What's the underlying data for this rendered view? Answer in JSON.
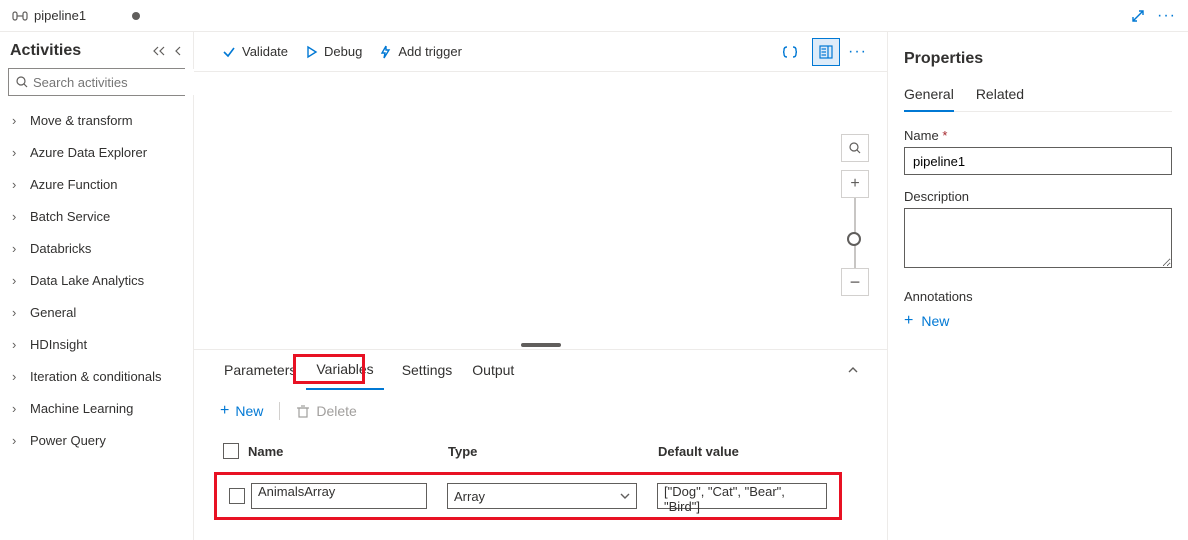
{
  "tab": {
    "title": "pipeline1"
  },
  "topbar_icons": {
    "expand": "expand",
    "more": "more"
  },
  "sidebar": {
    "title": "Activities",
    "search_placeholder": "Search activities",
    "categories": [
      "Move & transform",
      "Azure Data Explorer",
      "Azure Function",
      "Batch Service",
      "Databricks",
      "Data Lake Analytics",
      "General",
      "HDInsight",
      "Iteration & conditionals",
      "Machine Learning",
      "Power Query"
    ]
  },
  "toolbar": {
    "validate": "Validate",
    "debug": "Debug",
    "addtrigger": "Add trigger"
  },
  "bottom": {
    "tabs": {
      "parameters": "Parameters",
      "variables": "Variables",
      "settings": "Settings",
      "output": "Output"
    },
    "actions": {
      "new": "New",
      "delete": "Delete"
    },
    "columns": {
      "name": "Name",
      "type": "Type",
      "default": "Default value"
    },
    "row": {
      "name": "AnimalsArray",
      "type": "Array",
      "default": "[\"Dog\", \"Cat\", \"Bear\", \"Bird\"]"
    }
  },
  "properties": {
    "title": "Properties",
    "tabs": {
      "general": "General",
      "related": "Related"
    },
    "name_label": "Name",
    "name_value": "pipeline1",
    "description_label": "Description",
    "annotations_label": "Annotations",
    "new": "New"
  }
}
